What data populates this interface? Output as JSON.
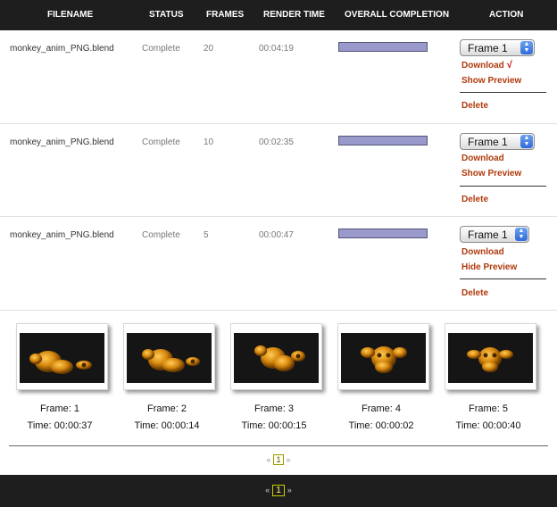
{
  "header": {
    "filename": "FILENAME",
    "status": "STATUS",
    "frames": "FRAMES",
    "render_time": "RENDER TIME",
    "overall_completion": "OVERALL COMPLETION",
    "action": "ACTION"
  },
  "jobs": [
    {
      "filename": "monkey_anim_PNG.blend",
      "status": "Complete",
      "frames": "20",
      "render_time": "00:04:19",
      "completion": 1.0,
      "frame_select": "Frame 1",
      "download": "Download",
      "download_check": "√",
      "preview": "Show Preview",
      "delete": "Delete"
    },
    {
      "filename": "monkey_anim_PNG.blend",
      "status": "Complete",
      "frames": "10",
      "render_time": "00:02:35",
      "completion": 1.0,
      "frame_select": "Frame 1",
      "download": "Download",
      "download_check": "",
      "preview": "Show Preview",
      "delete": "Delete"
    },
    {
      "filename": "monkey_anim_PNG.blend",
      "status": "Complete",
      "frames": "5",
      "render_time": "00:00:47",
      "completion": 1.0,
      "frame_select": "Frame 1",
      "download": "Download",
      "download_check": "",
      "preview": "Hide Preview",
      "delete": "Delete"
    }
  ],
  "preview_frames": [
    {
      "frame": "Frame: 1",
      "time": "Time: 00:00:37"
    },
    {
      "frame": "Frame: 2",
      "time": "Time: 00:00:14"
    },
    {
      "frame": "Frame: 3",
      "time": "Time: 00:00:15"
    },
    {
      "frame": "Frame: 4",
      "time": "Time: 00:00:02"
    },
    {
      "frame": "Frame: 5",
      "time": "Time: 00:00:40"
    }
  ],
  "preview_pager": {
    "prev": "«",
    "page": "1",
    "next": "»"
  },
  "main_pager": {
    "prev": "«",
    "page": "1",
    "next": "»"
  },
  "colors": {
    "header_bg": "#1e1e1e",
    "link": "#b03a0c",
    "progress": "#9999cc",
    "check": "#cc0000"
  }
}
